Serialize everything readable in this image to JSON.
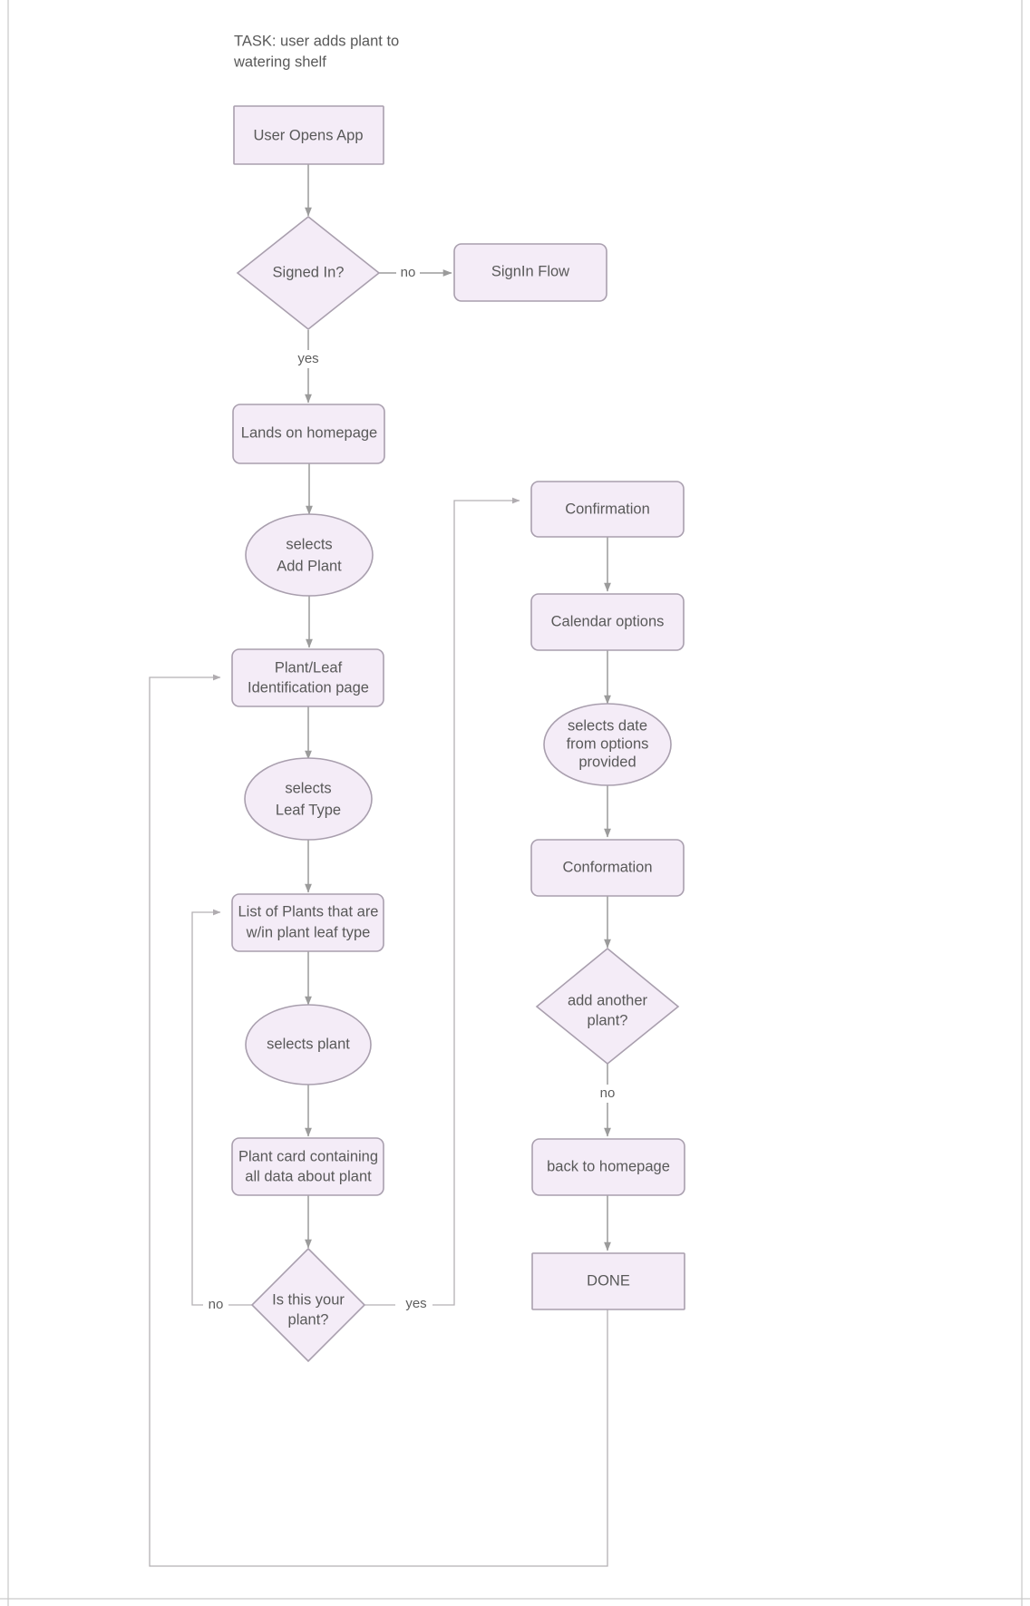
{
  "diagram": {
    "type": "flowchart",
    "title_line_1": "TASK: user adds plant to",
    "title_line_2": "watering shelf",
    "colors": {
      "node_fill": "#f4ecf7",
      "node_stroke": "#a99fae",
      "text": "#595959",
      "connector": "#9b9b9b",
      "background": "#ffffff"
    },
    "nodes": [
      {
        "id": "user_opens_app",
        "shape": "rectangle",
        "lines": [
          "User Opens App"
        ]
      },
      {
        "id": "signed_in",
        "shape": "diamond",
        "lines": [
          "Signed In?"
        ]
      },
      {
        "id": "signin_flow",
        "shape": "rounded-rectangle",
        "lines": [
          "SignIn Flow"
        ]
      },
      {
        "id": "lands_homepage",
        "shape": "rounded-rectangle",
        "lines": [
          "Lands on homepage"
        ]
      },
      {
        "id": "selects_add_plant",
        "shape": "ellipse",
        "lines": [
          "selects",
          "Add Plant"
        ]
      },
      {
        "id": "plant_leaf_id",
        "shape": "rounded-rectangle",
        "lines": [
          "Plant/Leaf",
          "Identification page"
        ]
      },
      {
        "id": "selects_leaf_type",
        "shape": "ellipse",
        "lines": [
          "selects",
          "Leaf Type"
        ]
      },
      {
        "id": "list_of_plants",
        "shape": "rounded-rectangle",
        "lines": [
          "List of Plants that are",
          "w/in plant leaf type"
        ]
      },
      {
        "id": "selects_plant",
        "shape": "ellipse",
        "lines": [
          "selects plant"
        ]
      },
      {
        "id": "plant_card",
        "shape": "rounded-rectangle",
        "lines": [
          "Plant card containing",
          "all data about plant"
        ]
      },
      {
        "id": "is_this_plant",
        "shape": "diamond",
        "lines": [
          "Is this your",
          "plant?"
        ]
      },
      {
        "id": "confirmation",
        "shape": "rounded-rectangle",
        "lines": [
          "Confirmation"
        ]
      },
      {
        "id": "calendar_options",
        "shape": "rounded-rectangle",
        "lines": [
          "Calendar options"
        ]
      },
      {
        "id": "selects_date",
        "shape": "ellipse",
        "lines": [
          "selects date",
          "from options",
          "provided"
        ]
      },
      {
        "id": "conformation",
        "shape": "rounded-rectangle",
        "lines": [
          "Conformation"
        ]
      },
      {
        "id": "add_another",
        "shape": "diamond",
        "lines": [
          "add another",
          "plant?"
        ]
      },
      {
        "id": "back_to_homepage",
        "shape": "rounded-rectangle",
        "lines": [
          "back to homepage"
        ]
      },
      {
        "id": "done",
        "shape": "rectangle",
        "lines": [
          "DONE"
        ]
      }
    ],
    "edges": [
      {
        "from": "user_opens_app",
        "to": "signed_in",
        "label": ""
      },
      {
        "from": "signed_in",
        "to": "signin_flow",
        "label": "no"
      },
      {
        "from": "signed_in",
        "to": "lands_homepage",
        "label": "yes"
      },
      {
        "from": "lands_homepage",
        "to": "selects_add_plant",
        "label": ""
      },
      {
        "from": "selects_add_plant",
        "to": "plant_leaf_id",
        "label": ""
      },
      {
        "from": "plant_leaf_id",
        "to": "selects_leaf_type",
        "label": ""
      },
      {
        "from": "selects_leaf_type",
        "to": "list_of_plants",
        "label": ""
      },
      {
        "from": "list_of_plants",
        "to": "selects_plant",
        "label": ""
      },
      {
        "from": "selects_plant",
        "to": "plant_card",
        "label": ""
      },
      {
        "from": "plant_card",
        "to": "is_this_plant",
        "label": ""
      },
      {
        "from": "is_this_plant",
        "to": "list_of_plants",
        "label": "no"
      },
      {
        "from": "is_this_plant",
        "to": "confirmation",
        "label": "yes"
      },
      {
        "from": "confirmation",
        "to": "calendar_options",
        "label": ""
      },
      {
        "from": "calendar_options",
        "to": "selects_date",
        "label": ""
      },
      {
        "from": "selects_date",
        "to": "conformation",
        "label": ""
      },
      {
        "from": "conformation",
        "to": "add_another",
        "label": ""
      },
      {
        "from": "add_another",
        "to": "back_to_homepage",
        "label": "no"
      },
      {
        "from": "back_to_homepage",
        "to": "done",
        "label": ""
      },
      {
        "from": "done",
        "to": "plant_leaf_id",
        "label": ""
      }
    ],
    "edge_labels": {
      "signed_in_no": "no",
      "signed_in_yes": "yes",
      "is_this_plant_no": "no",
      "is_this_plant_yes": "yes",
      "add_another_no": "no"
    }
  }
}
